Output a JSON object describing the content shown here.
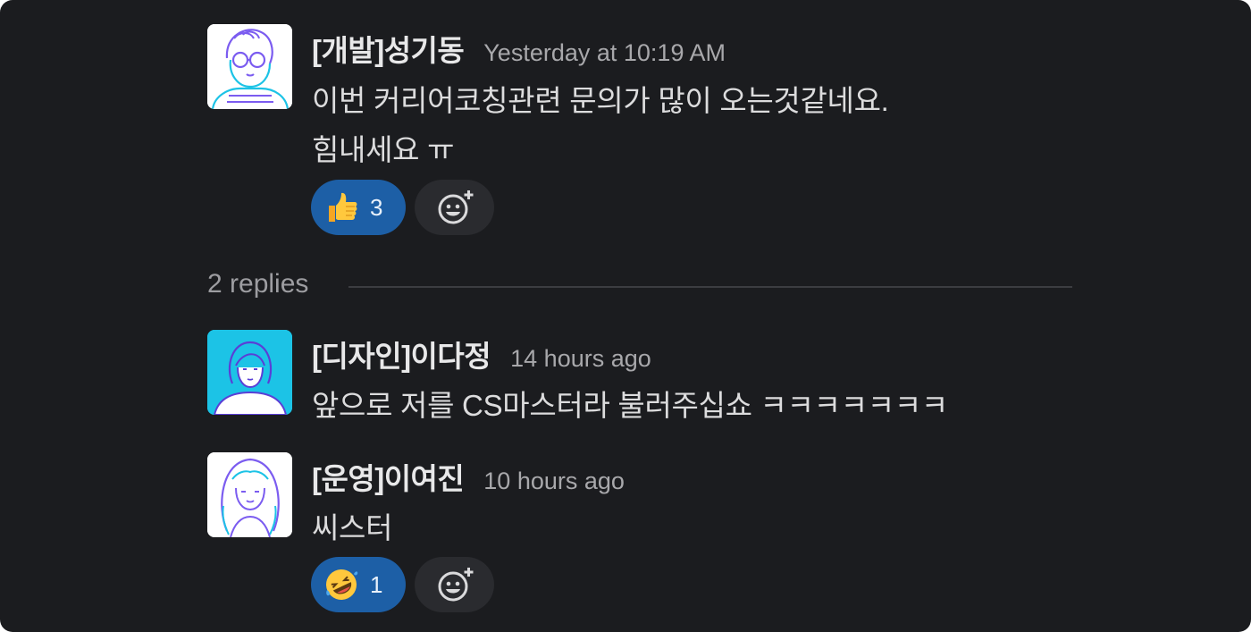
{
  "messages": [
    {
      "author": "[개발]성기동",
      "time": "Yesterday at 10:19 AM",
      "lines": [
        "이번 커리어코칭관련 문의가 많이 오는것같네요.",
        "힘내세요 ㅠ"
      ],
      "avatar_icon": "avatar-glasses-man-icon",
      "reaction": {
        "emoji": "👍",
        "icon": "thumbs-up-icon",
        "count": "3"
      }
    },
    {
      "author": "[디자인]이다정",
      "time": "14 hours ago",
      "lines": [
        "앞으로 저를 CS마스터라 불러주십쇼 ㅋㅋㅋㅋㅋㅋㅋ"
      ],
      "avatar_icon": "avatar-woman-cyan-icon"
    },
    {
      "author": "[운영]이여진",
      "time": "10 hours ago",
      "lines": [
        "씨스터"
      ],
      "avatar_icon": "avatar-woman-longhair-icon",
      "reaction": {
        "emoji": "🤣",
        "icon": "rolling-laughing-icon",
        "count": "1"
      }
    }
  ],
  "thread": {
    "replies_label": "2 replies"
  },
  "colors": {
    "background": "#1b1c1f",
    "reaction_active": "#1d5fa6",
    "reaction_add": "#2a2b2f",
    "avatar_cyan": "#1cc3e6"
  }
}
